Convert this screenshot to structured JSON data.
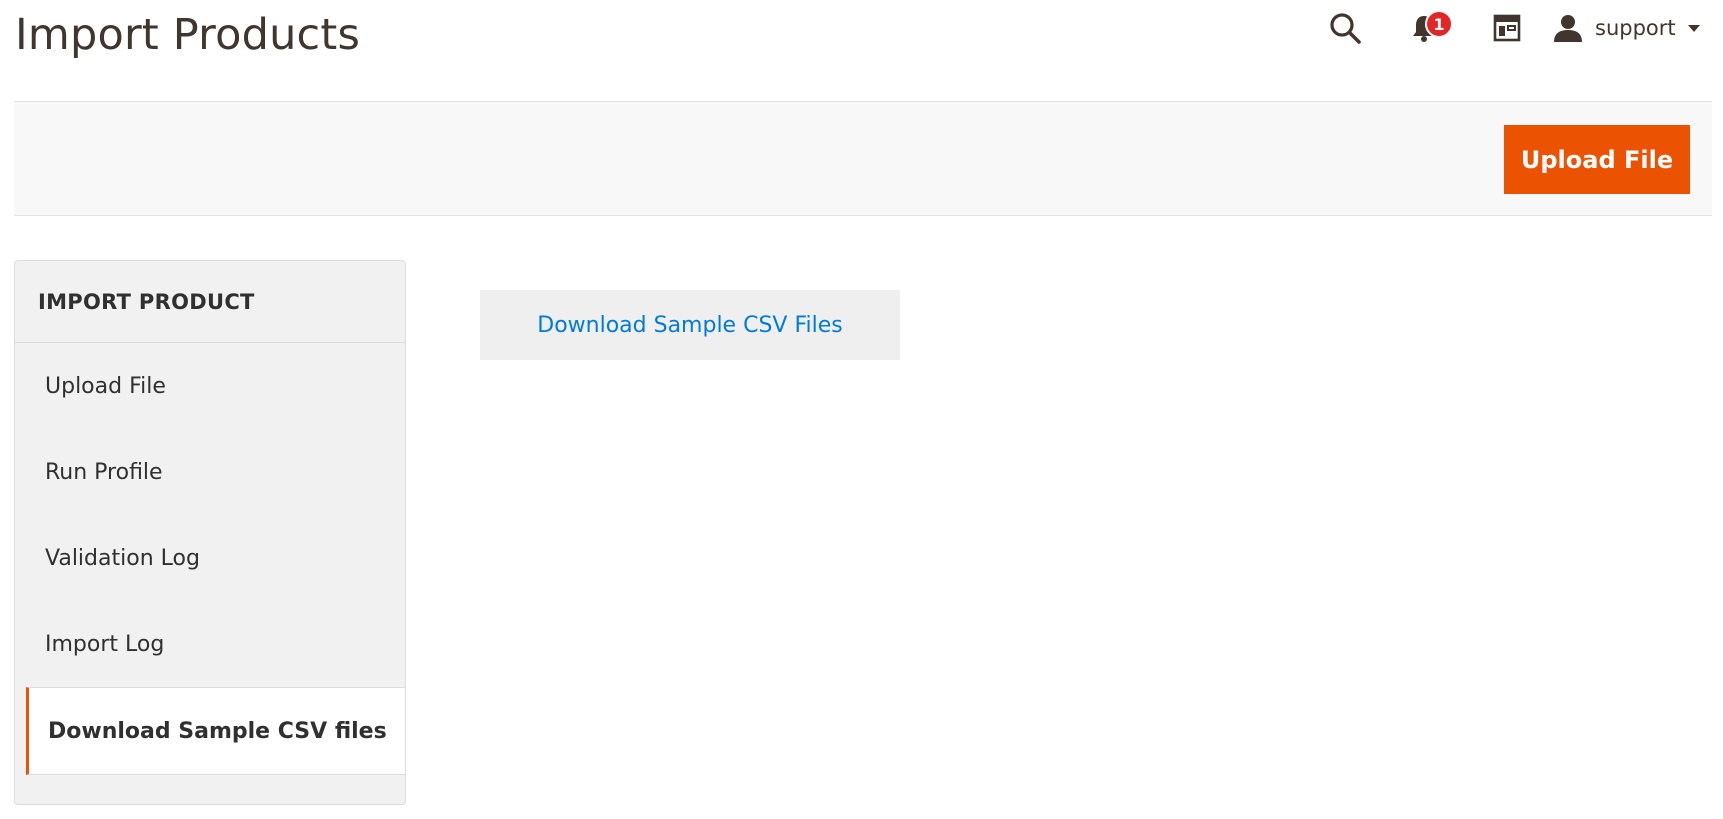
{
  "header": {
    "title": "Import Products",
    "notifications_count": "1",
    "user_name": "support"
  },
  "action_bar": {
    "upload_button": "Upload File"
  },
  "sidebar": {
    "title": "IMPORT PRODUCT",
    "items": [
      {
        "label": "Upload File",
        "active": false
      },
      {
        "label": "Run Profile",
        "active": false
      },
      {
        "label": "Validation Log",
        "active": false
      },
      {
        "label": "Import Log",
        "active": false
      },
      {
        "label": "Download Sample CSV files",
        "active": true
      }
    ]
  },
  "main": {
    "download_link": "Download Sample CSV Files"
  },
  "colors": {
    "accent": "#eb5202",
    "link": "#007bdb",
    "badge": "#e22626"
  }
}
